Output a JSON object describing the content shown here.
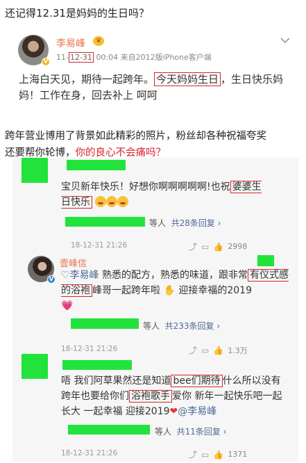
{
  "title": "还记得12.31是妈妈的生日吗？",
  "post": {
    "username": "李易峰",
    "date": "12-31",
    "time": "00:04",
    "source": "来自2012版iPhone客户端",
    "text_before": "上海白天见，期待一起跨年。",
    "text_highlight": "今天妈妈生日",
    "text_after": "，生日快乐妈妈！工作在身，回去补上 呵呵"
  },
  "caption": {
    "line1": "跨年营业博用了背景如此精彩的照片，粉丝却各种祝福夸奖",
    "line2_plain": "还要帮你轮博，",
    "line2_red": "你的良心不会痛吗？"
  },
  "comments": [
    {
      "text_before": "宝贝新年快乐！好想你啊啊啊啊啊!也祝",
      "highlight": "婆婆生日快乐",
      "replies_suffix": "等人",
      "replies_link": "共28条回复",
      "timestamp": "18-12-31 21:26",
      "likes": "2998"
    },
    {
      "username": "壹峰信",
      "mention": "李易峰",
      "text_before": "熟悉的配方，熟悉的味道，跟非常",
      "highlight": "有仪式感的浴袍",
      "text_after": "峰哥一起跨年啦",
      "text_tail": "迎接幸福的2019",
      "replies_suffix": "等人",
      "replies_link": "共233条回复",
      "timestamp": "18-12-31 21:26",
      "likes": "1.3万"
    },
    {
      "text_before": "唔 我们阿草果然还是知道",
      "highlight1": "bee们期待",
      "text_mid1": "什么所以没有跨年也要给你们",
      "highlight2": "浴袍歌手",
      "text_mid2": "爱你 新年一起快乐吧一起长大 一起幸福 迎接2019",
      "mention": "@李易峰",
      "replies_suffix": "等人",
      "replies_link": "共11条回复",
      "timestamp": "18-12-31 21:26",
      "likes": "1371"
    }
  ],
  "colors": {
    "accent_red": "#d8232a",
    "username_orange": "#eb7350",
    "censor_green": "#22e33b",
    "link_blue": "#506a97"
  },
  "icons": [
    "chevron-down-icon",
    "verified-badge-icon",
    "share-icon",
    "comment-icon",
    "like-icon"
  ]
}
